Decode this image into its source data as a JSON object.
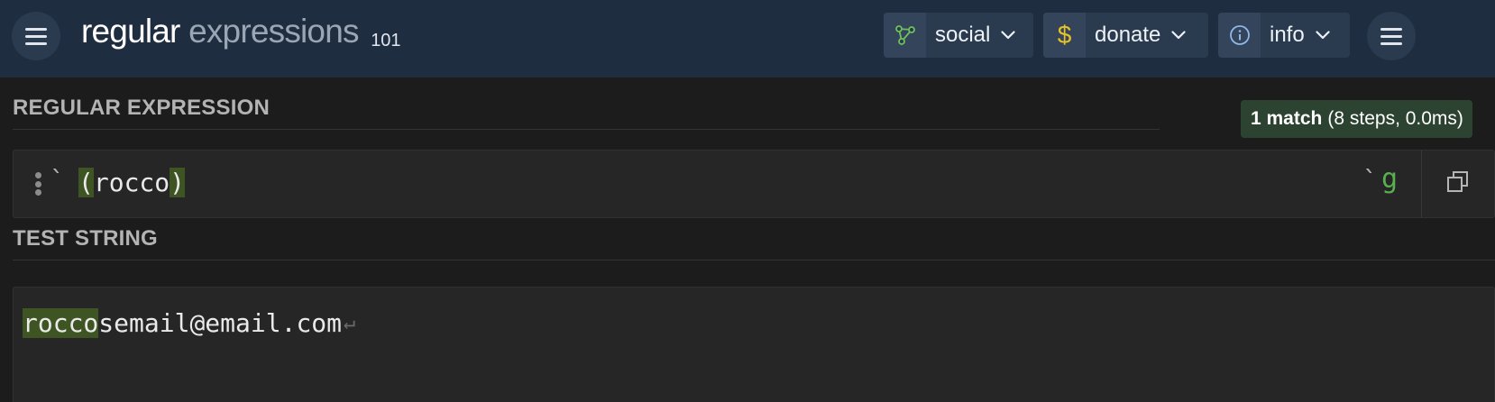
{
  "header": {
    "logo": {
      "word1": "regular",
      "word2": "expressions",
      "num": "101"
    },
    "nav": {
      "social": {
        "label": "social",
        "icon": "share-icon"
      },
      "donate": {
        "label": "donate",
        "icon": "dollar-icon"
      },
      "info": {
        "label": "info",
        "icon": "info-icon"
      }
    }
  },
  "regex": {
    "title": "REGULAR EXPRESSION",
    "match_count": "1 match",
    "match_details": "(8 steps, 0.0ms)",
    "open_delimiter": "`",
    "close_delimiter": "`",
    "pattern": {
      "open_paren": "(",
      "body": "rocco",
      "close_paren": ")"
    },
    "flags": "g"
  },
  "test": {
    "title": "TEST STRING",
    "match": "rocco",
    "rest": "semail@email.com",
    "newline_mark": "↵"
  },
  "colors": {
    "header_bg": "#1f2d40",
    "body_bg": "#1c1c1c",
    "match_highlight": "#3f5423",
    "flag_green": "#58b04e",
    "badge_bg": "#2d4331",
    "dollar_yellow": "#e6c229",
    "share_green": "#6fbf5a",
    "info_blue": "#8fb8e6"
  }
}
